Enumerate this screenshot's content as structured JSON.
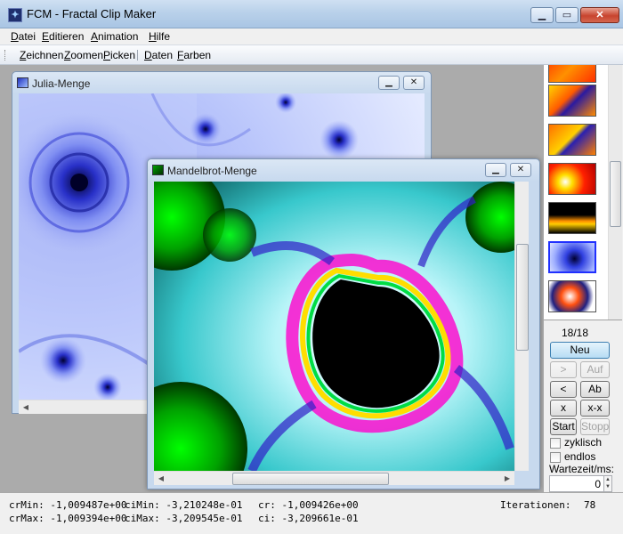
{
  "app": {
    "title": "FCM - Fractal Clip Maker"
  },
  "menu": [
    "Datei",
    "Editieren",
    "Animation",
    "Hilfe"
  ],
  "toolbar": {
    "group1": [
      "Zeichnen",
      "Zoomen",
      "Picken"
    ],
    "group2": [
      "Daten",
      "Farben"
    ]
  },
  "windows": {
    "julia": {
      "title": "Julia-Menge"
    },
    "mandelbrot": {
      "title": "Mandelbrot-Menge"
    }
  },
  "panel": {
    "counter": "18/18",
    "buttons": {
      "neu": "Neu",
      "next": ">",
      "auf": "Auf",
      "prev": "<",
      "ab": "Ab",
      "x": "x",
      "xx": "x-x",
      "start": "Start",
      "stopp": "Stopp"
    },
    "checks": {
      "zyklisch": "zyklisch",
      "endlos": "endlos"
    },
    "wartezeit_label": "Wartezeit/ms:",
    "wartezeit_value": "0"
  },
  "status": {
    "crMin": "crMin: -1,009487e+00",
    "crMax": "crMax: -1,009394e+00",
    "ciMin": "ciMin: -3,210248e-01",
    "ciMax": "ciMax: -3,209545e-01",
    "cr": "cr: -1,009426e+00",
    "ci": "ci: -3,209661e-01",
    "iter_label": "Iterationen:",
    "iter_value": "78"
  },
  "colors": {
    "titlebar": "#b9d1ea",
    "mdi": "#ababab",
    "accent": "#3c7fb1"
  }
}
